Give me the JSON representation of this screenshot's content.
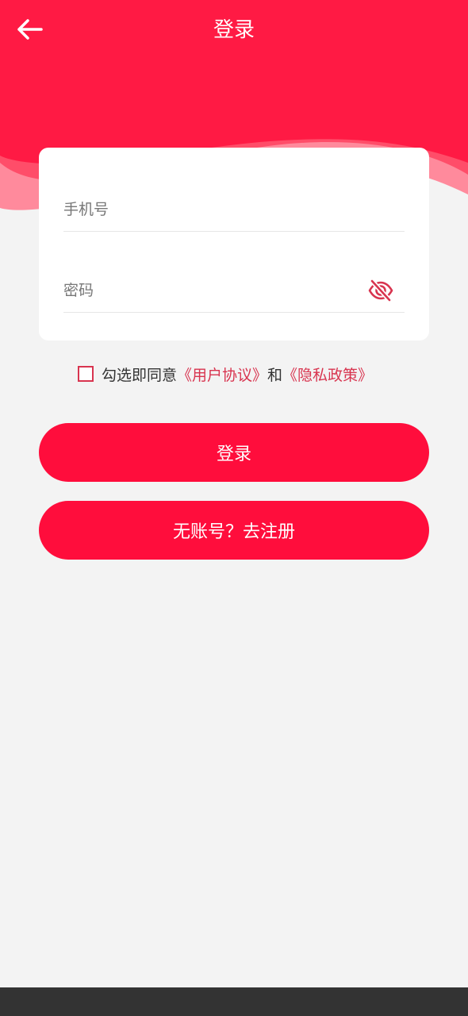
{
  "header": {
    "title": "登录",
    "back_icon": "arrow-left-icon",
    "background_color": "#ff1a44"
  },
  "form": {
    "phone_placeholder": "手机号",
    "password_placeholder": "密码",
    "password_toggle_icon": "eye-off-icon"
  },
  "agreement": {
    "prefix": "勾选即同意",
    "user_agreement": "《用户协议》",
    "conjunction": "和",
    "privacy_policy": "《隐私政策》",
    "checked": false
  },
  "buttons": {
    "login_label": "登录",
    "register_label": "无账号？去注册",
    "color": "#ff0d3c"
  }
}
